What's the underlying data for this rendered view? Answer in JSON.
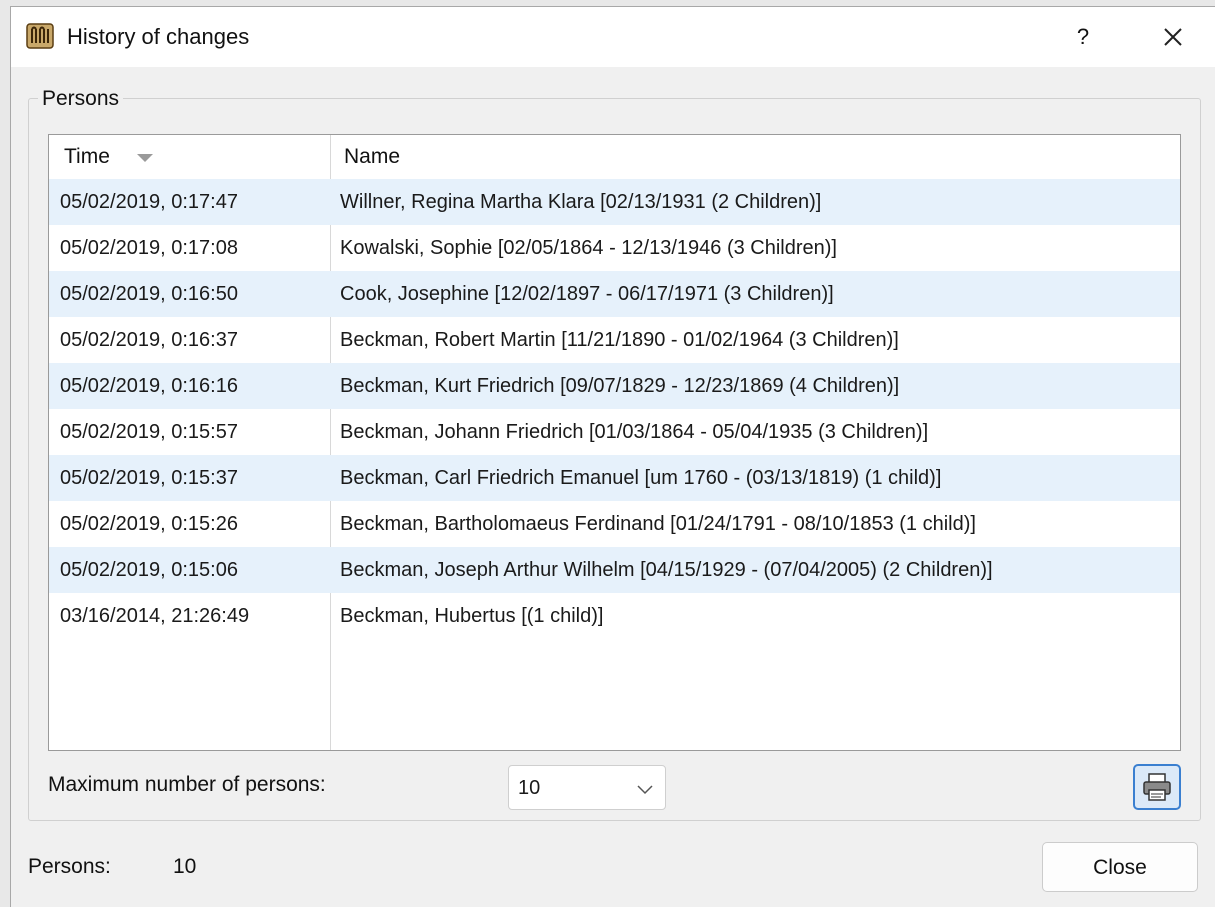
{
  "window": {
    "title": "History of changes",
    "help_label": "?"
  },
  "group": {
    "title": "Persons"
  },
  "table": {
    "columns": {
      "time": "Time",
      "name": "Name"
    },
    "rows": [
      {
        "time": "05/02/2019, 0:17:47",
        "name": "Willner, Regina Martha Klara [02/13/1931 (2 Children)]"
      },
      {
        "time": "05/02/2019, 0:17:08",
        "name": "Kowalski, Sophie [02/05/1864 - 12/13/1946 (3 Children)]"
      },
      {
        "time": "05/02/2019, 0:16:50",
        "name": "Cook, Josephine [12/02/1897 - 06/17/1971 (3 Children)]"
      },
      {
        "time": "05/02/2019, 0:16:37",
        "name": "Beckman, Robert Martin [11/21/1890 - 01/02/1964 (3 Children)]"
      },
      {
        "time": "05/02/2019, 0:16:16",
        "name": "Beckman, Kurt Friedrich [09/07/1829 - 12/23/1869 (4 Children)]"
      },
      {
        "time": "05/02/2019, 0:15:57",
        "name": "Beckman, Johann Friedrich [01/03/1864 - 05/04/1935 (3 Children)]"
      },
      {
        "time": "05/02/2019, 0:15:37",
        "name": "Beckman, Carl Friedrich Emanuel [um 1760 - (03/13/1819) (1 child)]"
      },
      {
        "time": "05/02/2019, 0:15:26",
        "name": "Beckman, Bartholomaeus Ferdinand [01/24/1791 - 08/10/1853 (1 child)]"
      },
      {
        "time": "05/02/2019, 0:15:06",
        "name": "Beckman, Joseph Arthur Wilhelm [04/15/1929 - (07/04/2005) (2 Children)]"
      },
      {
        "time": "03/16/2014, 21:26:49",
        "name": "Beckman, Hubertus [(1 child)]"
      }
    ]
  },
  "max_persons": {
    "label": "Maximum number of persons:",
    "value": "10"
  },
  "footer": {
    "persons_label": "Persons:",
    "persons_count": "10",
    "close_label": "Close"
  },
  "colors": {
    "row_alt": "#e6f1fb",
    "print_accent": "#3a7fd0"
  },
  "icons": {
    "app": "app-logo-icon",
    "close": "close-icon",
    "dropdown": "chevron-down-icon",
    "print": "printer-icon"
  }
}
